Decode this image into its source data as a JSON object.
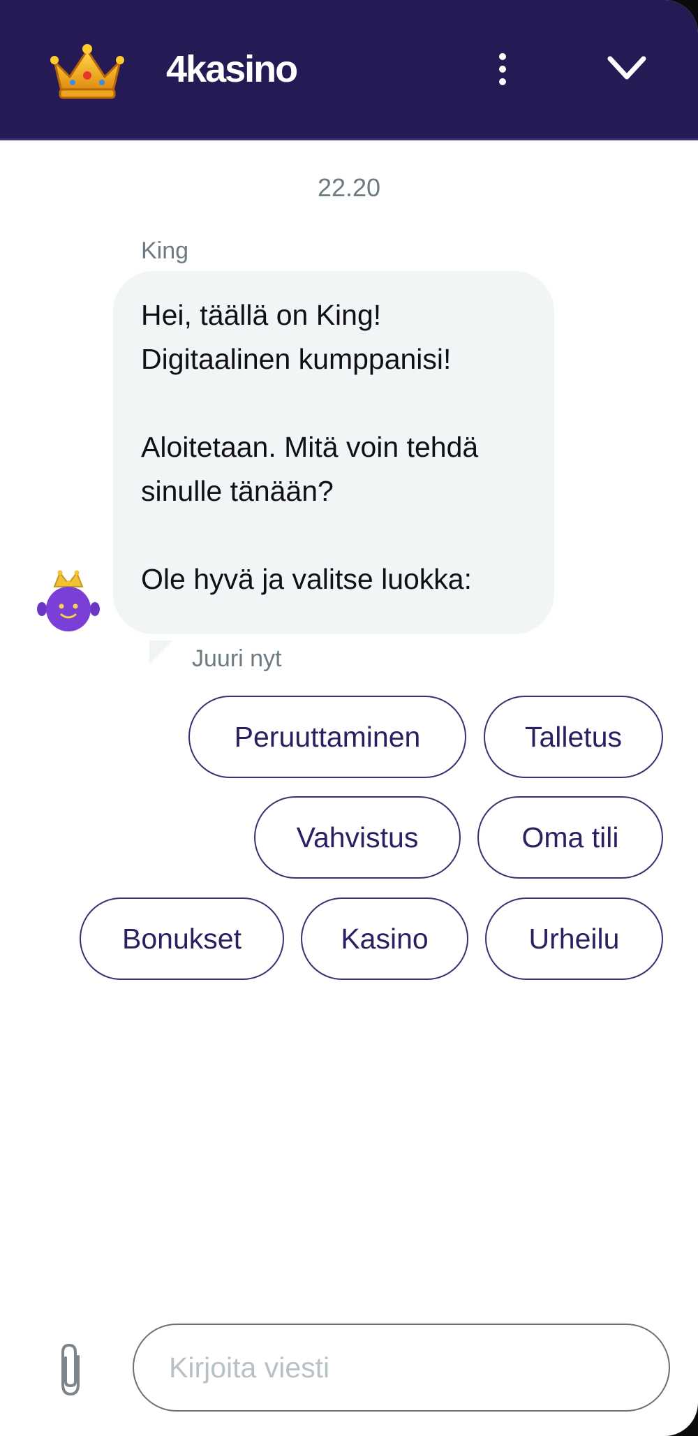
{
  "header": {
    "title": "4kasino",
    "logo_icon": "crown-icon",
    "menu_icon": "more-vertical-icon",
    "collapse_icon": "chevron-down-icon",
    "background": "#261a54"
  },
  "chat": {
    "timestamp": "22.20",
    "message": {
      "sender": "King",
      "lines": [
        "Hei, täällä on King!",
        "Digitaalinen kumppanisi!",
        "Aloitetaan. Mitä voin tehdä",
        "sinulle tänään?",
        "Ole hyvä ja valitse luokka:"
      ],
      "time": "Juuri nyt",
      "avatar_icon": "bot-avatar-icon"
    },
    "quick_replies": [
      "Peruuttaminen",
      "Talletus",
      "Vahvistus",
      "Oma tili",
      "Bonukset",
      "Kasino",
      "Urheilu"
    ]
  },
  "composer": {
    "placeholder": "Kirjoita viesti",
    "attach_icon": "paperclip-icon"
  },
  "colors": {
    "accent": "#261a54",
    "bubble": "#f2f5f6",
    "chip_border": "#3a3070",
    "muted_text": "#6d7a82"
  }
}
